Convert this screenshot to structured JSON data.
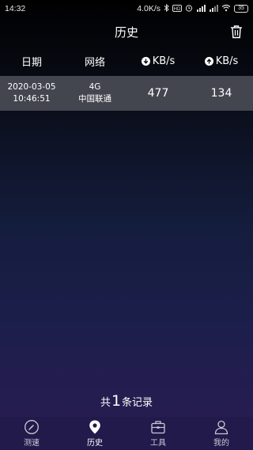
{
  "status_bar": {
    "time": "14:32",
    "net_speed": "4.0K/s",
    "battery": "35"
  },
  "header": {
    "title": "历史"
  },
  "columns": {
    "date": "日期",
    "network": "网络",
    "download": "KB/s",
    "upload": "KB/s"
  },
  "records": [
    {
      "date": "2020-03-05",
      "time": "10:46:51",
      "network_type": "4G",
      "carrier": "中国联通",
      "download": "477",
      "upload": "134"
    }
  ],
  "footer": {
    "prefix": "共",
    "count": "1",
    "suffix": "条记录"
  },
  "nav": [
    {
      "label": "测速",
      "icon": "speedometer-icon",
      "active": false
    },
    {
      "label": "历史",
      "icon": "location-pin-icon",
      "active": true
    },
    {
      "label": "工具",
      "icon": "toolbox-icon",
      "active": false
    },
    {
      "label": "我的",
      "icon": "user-icon",
      "active": false
    }
  ],
  "colors": {
    "row_bg": "#44464f",
    "nav_label": "#c9c9d6"
  }
}
